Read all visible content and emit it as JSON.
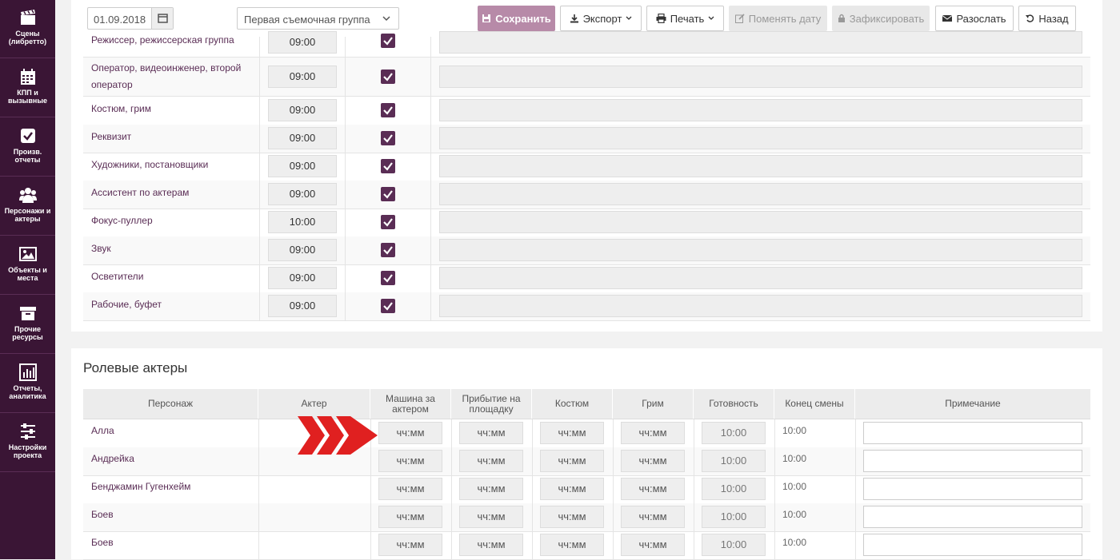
{
  "sidebar": {
    "items": [
      {
        "label1": "Сцены",
        "label2": "(либретто)",
        "icon": "clapperboard-icon"
      },
      {
        "label1": "КПП и",
        "label2": "вызывные",
        "icon": "calendar-icon"
      },
      {
        "label1": "Произв.",
        "label2": "отчеты",
        "icon": "checkbox-icon"
      },
      {
        "label1": "Персонажи и",
        "label2": "актеры",
        "icon": "people-icon"
      },
      {
        "label1": "Объекты и",
        "label2": "места",
        "icon": "picture-icon"
      },
      {
        "label1": "Прочие",
        "label2": "ресурсы",
        "icon": "archive-icon"
      },
      {
        "label1": "Отчеты,",
        "label2": "аналитика",
        "icon": "bar-chart-icon"
      },
      {
        "label1": "Настройки",
        "label2": "проекта",
        "icon": "sliders-icon"
      }
    ]
  },
  "toolbar": {
    "date": "01.09.2018",
    "group": "Первая съемочная группа",
    "save": "Сохранить",
    "export": "Экспорт",
    "print": "Печать",
    "change_date": "Поменять дату",
    "fix": "Зафиксировать",
    "send": "Разослать",
    "back": "Назад"
  },
  "crew": [
    {
      "name": "Режиссер, режиссерская группа",
      "time": "09:00",
      "checked": true
    },
    {
      "name": "Оператор, видеоинженер, второй оператор",
      "time": "09:00",
      "checked": true
    },
    {
      "name": "Костюм, грим",
      "time": "09:00",
      "checked": true
    },
    {
      "name": "Реквизит",
      "time": "09:00",
      "checked": true
    },
    {
      "name": "Художники, постановщики",
      "time": "09:00",
      "checked": true
    },
    {
      "name": "Ассистент по актерам",
      "time": "09:00",
      "checked": true
    },
    {
      "name": "Фокус-пуллер",
      "time": "10:00",
      "checked": true
    },
    {
      "name": "Звук",
      "time": "09:00",
      "checked": true
    },
    {
      "name": "Осветители",
      "time": "09:00",
      "checked": true
    },
    {
      "name": "Рабочие, буфет",
      "time": "09:00",
      "checked": true
    }
  ],
  "actors_section": {
    "title": "Ролевые актеры",
    "headers": {
      "character": "Персонаж",
      "actor": "Актер",
      "car": "Машина за актером",
      "arrival": "Прибытие на площадку",
      "costume": "Костюм",
      "makeup": "Грим",
      "ready": "Готовность",
      "end": "Конец смены",
      "note": "Примечание"
    },
    "placeholder": "чч:мм",
    "rows": [
      {
        "character": "Алла",
        "actor": "",
        "ready": "10:00",
        "end": "10:00"
      },
      {
        "character": "Андрейка",
        "actor": "",
        "ready": "10:00",
        "end": "10:00"
      },
      {
        "character": "Бенджамин Гугенхейм",
        "actor": "",
        "ready": "10:00",
        "end": "10:00"
      },
      {
        "character": "Боев",
        "actor": "",
        "ready": "10:00",
        "end": "10:00"
      },
      {
        "character": "Боев",
        "actor": "",
        "ready": "10:00",
        "end": "10:00"
      }
    ]
  },
  "colors": {
    "sidebar": "#3a1535",
    "accent": "#5a2d55",
    "primary_button": "#b78aa8",
    "arrow": "#e02020"
  }
}
